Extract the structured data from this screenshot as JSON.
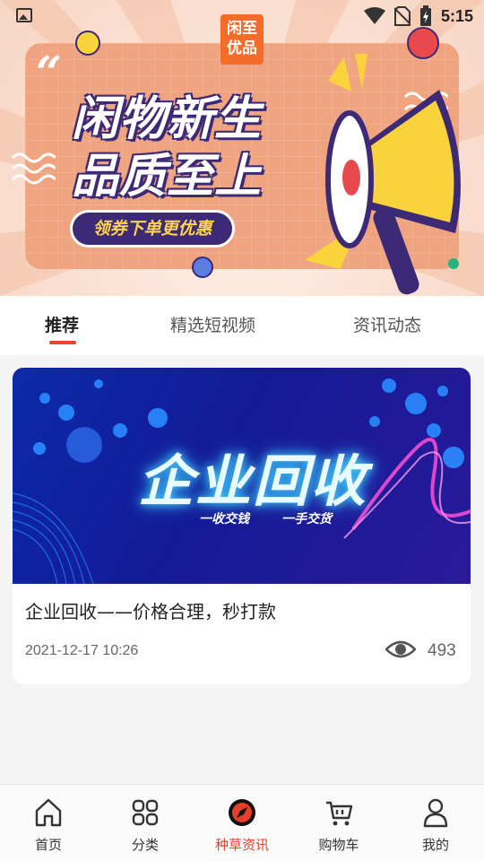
{
  "status_bar": {
    "time": "5:15"
  },
  "banner": {
    "logo_line1": "闲至",
    "logo_line2": "优品",
    "quote_mark": "“",
    "headline_line1": "闲物新生",
    "headline_line2": "品质至上",
    "cta": "领券下单更优惠"
  },
  "tabs": [
    {
      "label": "推荐",
      "active": true
    },
    {
      "label": "精选短视频",
      "active": false
    },
    {
      "label": "资讯动态",
      "active": false
    }
  ],
  "article": {
    "image_title": "企业回收",
    "image_sub1": "一收交钱",
    "image_sub2": "一手交货",
    "title": "企业回收——价格合理，秒打款",
    "date": "2021-12-17 10:26",
    "views": "493"
  },
  "bottom_nav": [
    {
      "label": "首页",
      "icon": "home-icon",
      "active": false
    },
    {
      "label": "分类",
      "icon": "grid-icon",
      "active": false
    },
    {
      "label": "种草资讯",
      "icon": "compass-icon",
      "active": true
    },
    {
      "label": "购物车",
      "icon": "cart-icon",
      "active": false
    },
    {
      "label": "我的",
      "icon": "user-icon",
      "active": false
    }
  ],
  "colors": {
    "accent": "#e33f2a",
    "banner_navy": "#3c2a76",
    "banner_orange": "#f0a37f"
  }
}
